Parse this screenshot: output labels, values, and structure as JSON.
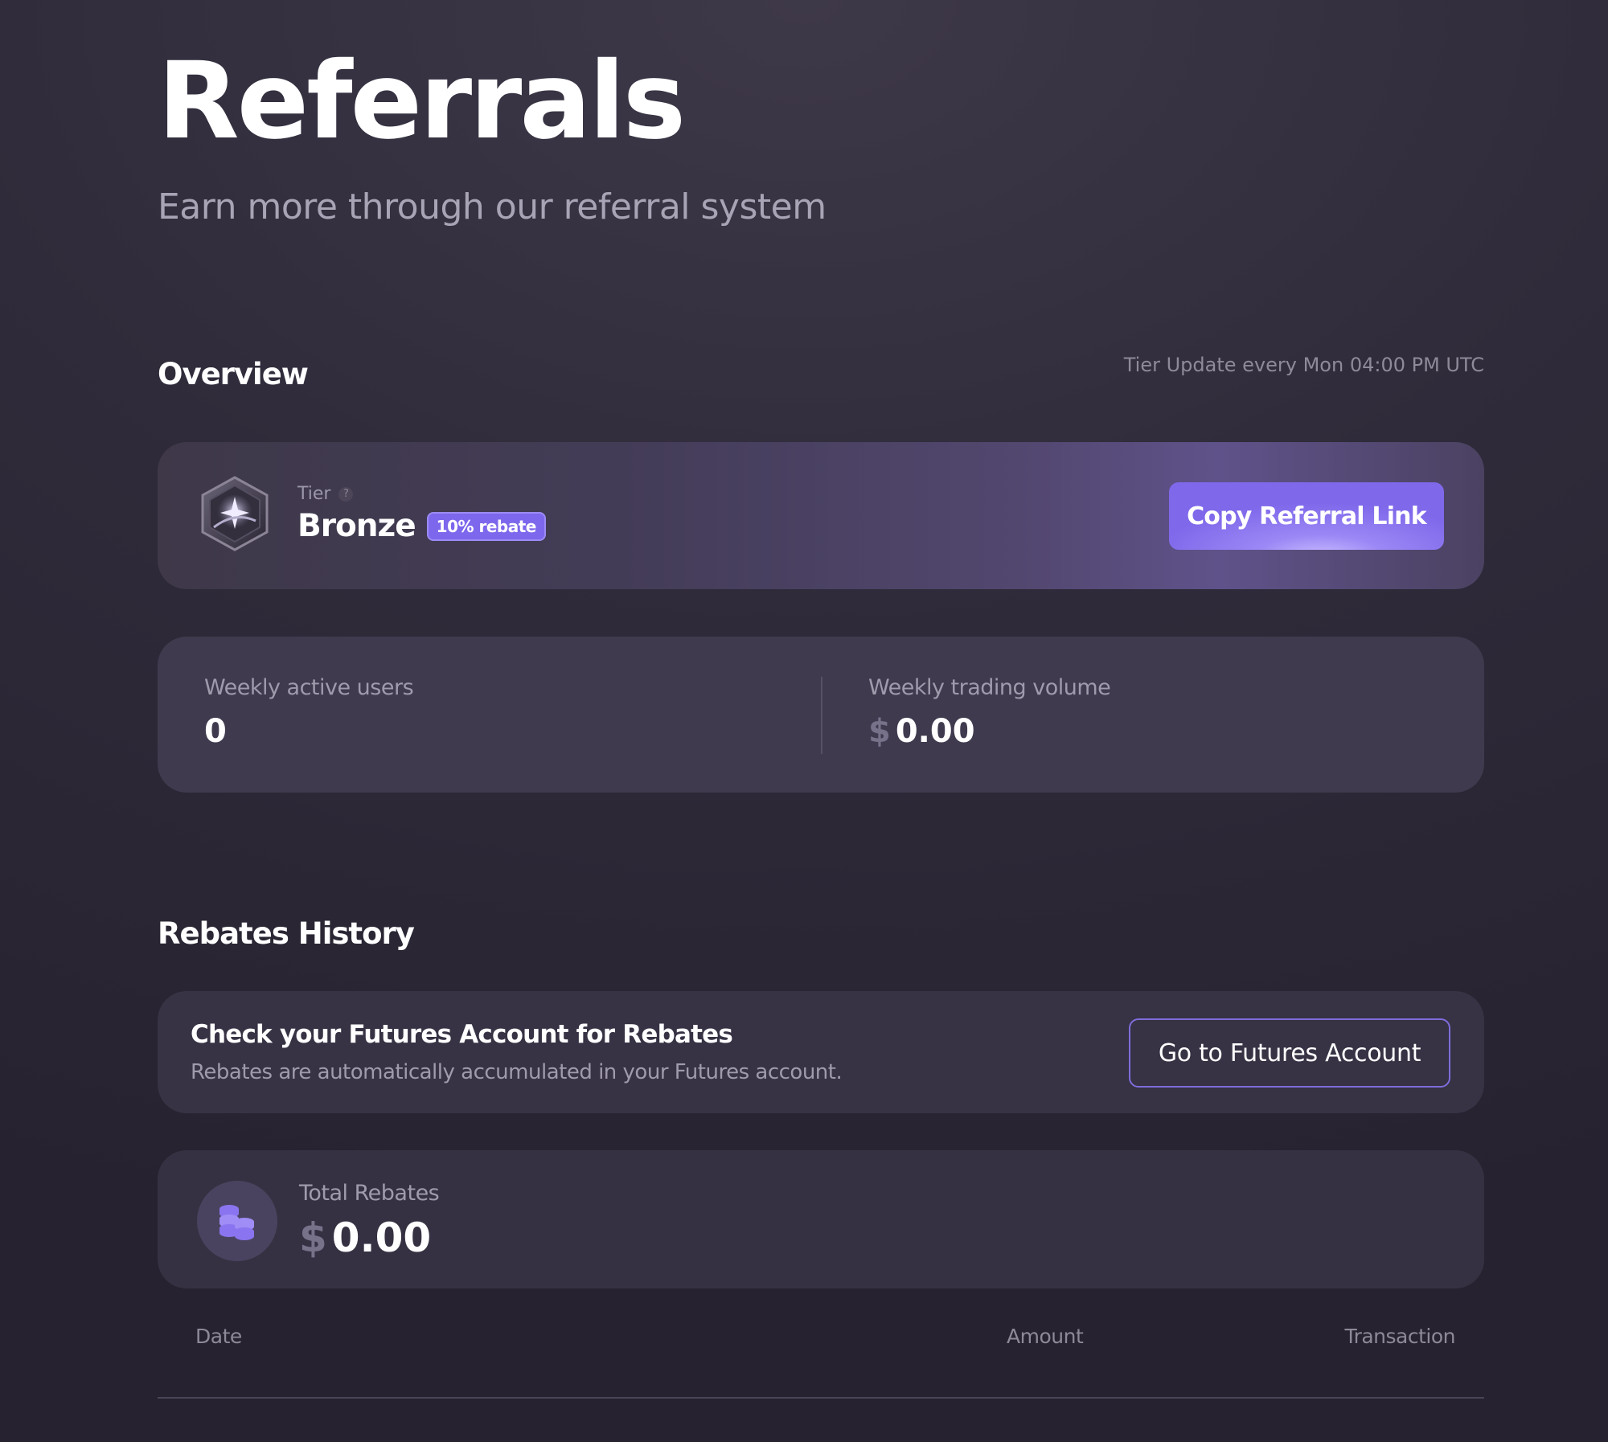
{
  "header": {
    "title": "Referrals",
    "subtitle": "Earn more through our referral system"
  },
  "overview": {
    "section_title": "Overview",
    "tier_update_note": "Tier Update every Mon 04:00 PM UTC",
    "tier": {
      "label": "Tier",
      "help_icon": "?",
      "name": "Bronze",
      "rebate_badge": "10% rebate",
      "badge_icon": "bronze-tier-badge-icon"
    },
    "copy_button": "Copy Referral Link",
    "stats": {
      "weekly_active_users": {
        "label": "Weekly active users",
        "value": "0"
      },
      "weekly_trading_volume": {
        "label": "Weekly trading volume",
        "currency": "$",
        "value": "0.00"
      }
    }
  },
  "rebates": {
    "section_title": "Rebates History",
    "futures_notice": {
      "title": "Check your Futures Account for Rebates",
      "description": "Rebates are automatically accumulated in your Futures account.",
      "button": "Go to Futures Account"
    },
    "total": {
      "label": "Total Rebates",
      "currency": "$",
      "value": "0.00",
      "icon": "coins-stack-icon"
    },
    "table": {
      "columns": [
        "Date",
        "Amount",
        "Transaction"
      ]
    }
  },
  "colors": {
    "accent": "#7d67ec",
    "button_gradient_light": "#c9bcff",
    "background": "#2f2b3a"
  }
}
